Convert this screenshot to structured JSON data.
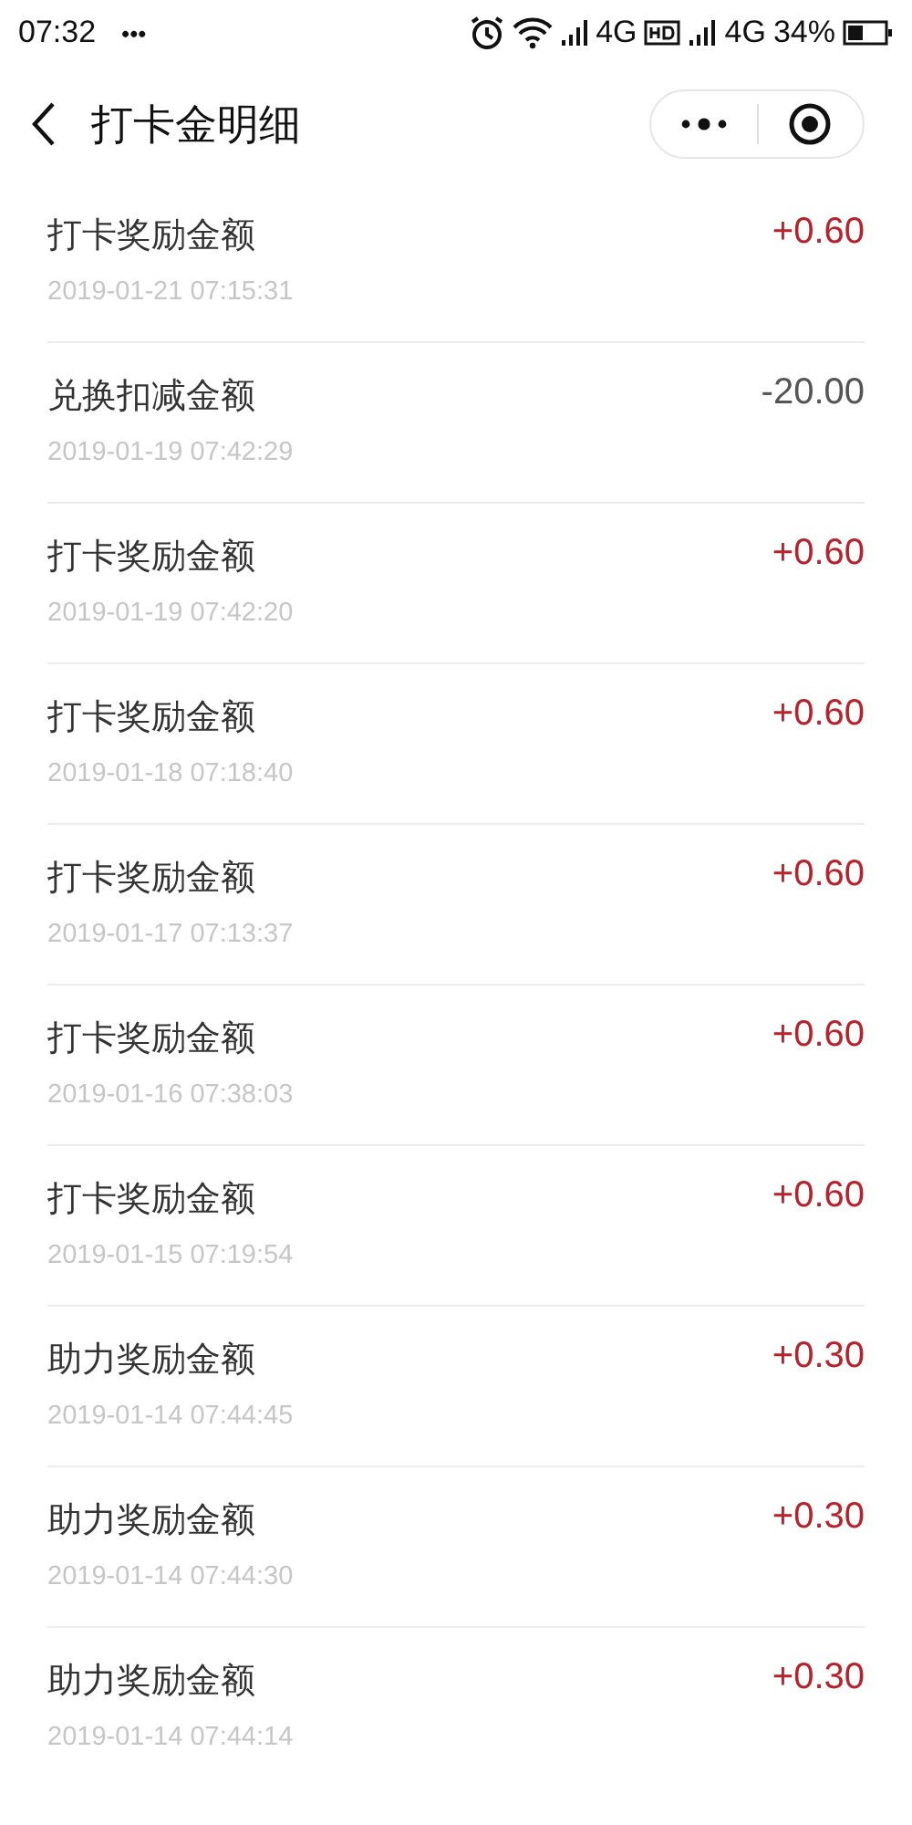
{
  "status_bar": {
    "time": "07:32",
    "dots": "•••",
    "network_1": "4G",
    "network_2": "4G",
    "battery": "34%"
  },
  "header": {
    "title": "打卡金明细"
  },
  "records": [
    {
      "title": "打卡奖励金额",
      "date": "2019-01-21 07:15:31",
      "amount": "+0.60",
      "kind": "credit"
    },
    {
      "title": "兑换扣减金额",
      "date": "2019-01-19 07:42:29",
      "amount": "-20.00",
      "kind": "debit"
    },
    {
      "title": "打卡奖励金额",
      "date": "2019-01-19 07:42:20",
      "amount": "+0.60",
      "kind": "credit"
    },
    {
      "title": "打卡奖励金额",
      "date": "2019-01-18 07:18:40",
      "amount": "+0.60",
      "kind": "credit"
    },
    {
      "title": "打卡奖励金额",
      "date": "2019-01-17 07:13:37",
      "amount": "+0.60",
      "kind": "credit"
    },
    {
      "title": "打卡奖励金额",
      "date": "2019-01-16 07:38:03",
      "amount": "+0.60",
      "kind": "credit"
    },
    {
      "title": "打卡奖励金额",
      "date": "2019-01-15 07:19:54",
      "amount": "+0.60",
      "kind": "credit"
    },
    {
      "title": "助力奖励金额",
      "date": "2019-01-14 07:44:45",
      "amount": "+0.30",
      "kind": "credit"
    },
    {
      "title": "助力奖励金额",
      "date": "2019-01-14 07:44:30",
      "amount": "+0.30",
      "kind": "credit"
    },
    {
      "title": "助力奖励金额",
      "date": "2019-01-14 07:44:14",
      "amount": "+0.30",
      "kind": "credit"
    }
  ]
}
